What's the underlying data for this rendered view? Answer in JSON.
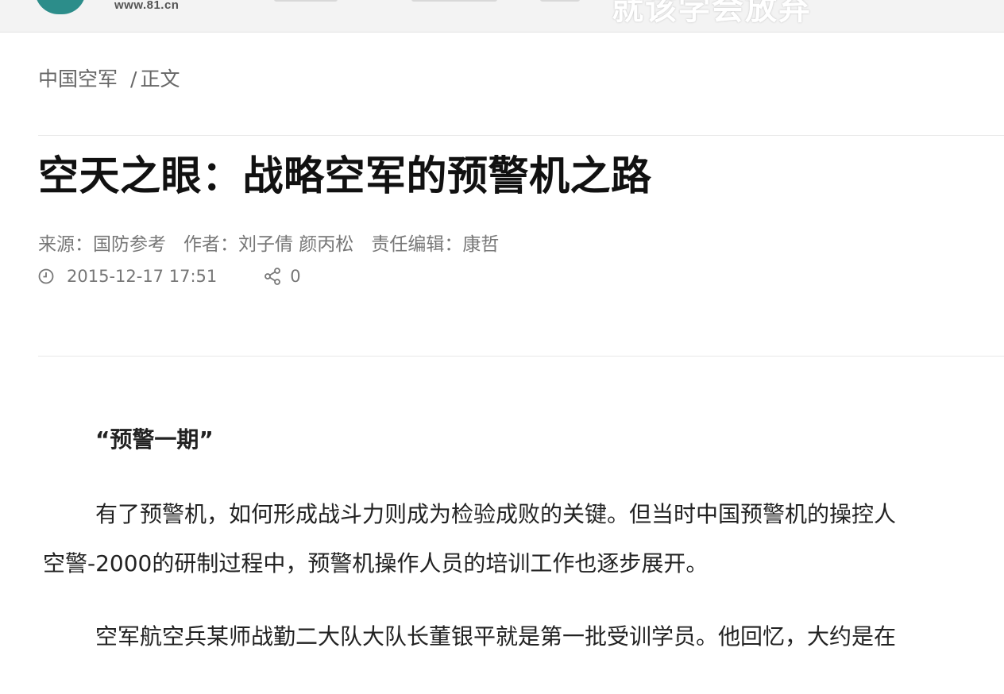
{
  "site": {
    "url": "www.81.cn",
    "overlay_text": "就该学会放弃"
  },
  "breadcrumb": {
    "section": "中国空军",
    "separator": "/",
    "current": "正文"
  },
  "article": {
    "title": "空天之眼：战略空军的预警机之路",
    "source_label": "来源：",
    "source": "国防参考",
    "author_label": "作者：",
    "authors": "刘子倩 颜丙松",
    "editor_label": "责任编辑：",
    "editor": "康哲",
    "datetime": "2015-12-17 17:51",
    "share_count": "0",
    "subheading": "“预警一期”",
    "paragraphs": [
      "有了预警机，如何形成战斗力则成为检验成败的关键。但当时中国预警机的操控人",
      "空警-2000的研制过程中，预警机操作人员的培训工作也逐步展开。",
      "空军航空兵某师战勤二大队大队长董银平就是第一批受训学员。他回忆，大约是在"
    ]
  },
  "icons": {
    "clock": "clock-icon",
    "share": "share-icon",
    "logo": "logo-icon"
  },
  "colors": {
    "logo": "#2c8d8a",
    "topbar": "#f3f3f3",
    "meta_text": "#777777"
  }
}
